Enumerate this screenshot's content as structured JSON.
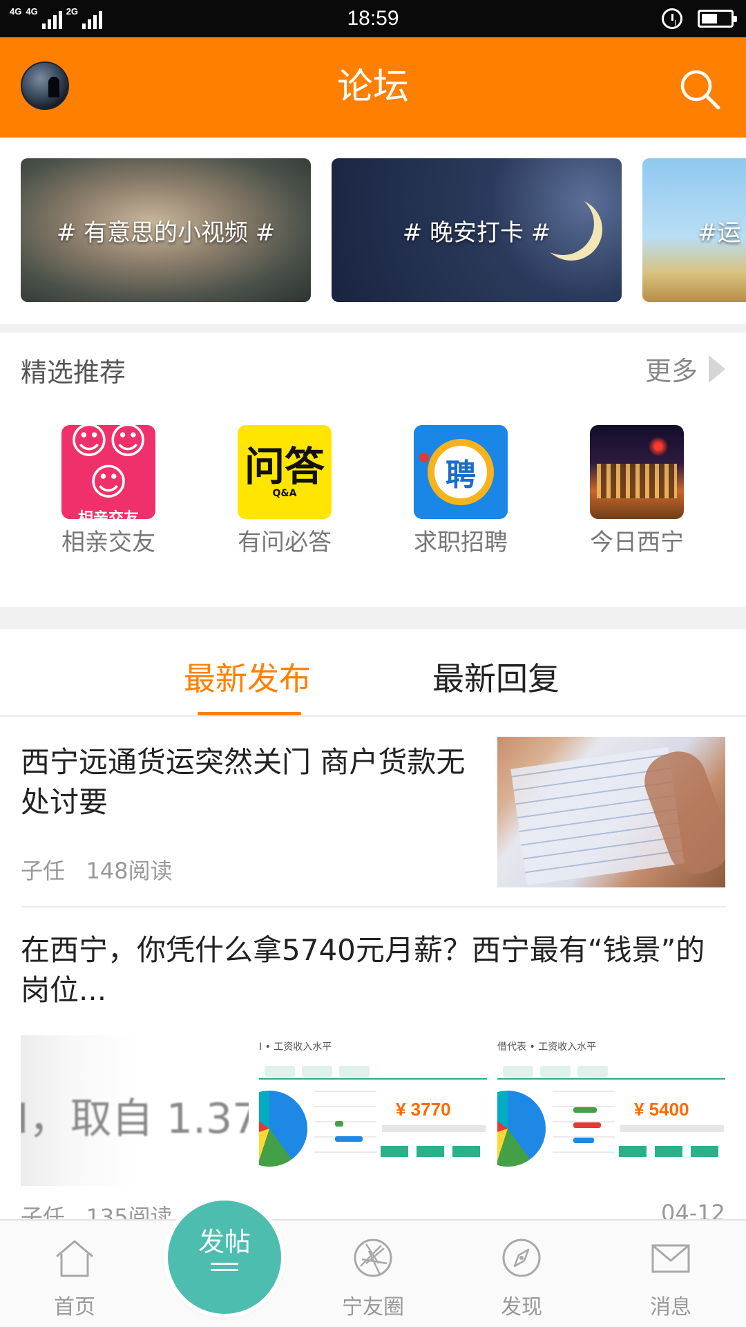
{
  "status_bar": {
    "network_1": "4G",
    "network_2": "4G",
    "network_3": "2G",
    "time": "18:59",
    "battery_level": 0.55
  },
  "header": {
    "title": "论坛",
    "search_icon": "search-icon",
    "avatar_icon": "avatar"
  },
  "banners": [
    {
      "label": "# 有意思的小视频 #"
    },
    {
      "label": "# 晚安打卡 #"
    },
    {
      "label": "#运"
    }
  ],
  "featured": {
    "title": "精选推荐",
    "more_label": "更多",
    "items": [
      {
        "label": "相亲交友",
        "icon_caption": "相亲交友",
        "icon": "dating-icon"
      },
      {
        "label": "有问必答",
        "icon_big": "问答",
        "icon_small": "Q&A",
        "icon": "qa-icon"
      },
      {
        "label": "求职招聘",
        "icon_char": "聘",
        "icon": "job-icon"
      },
      {
        "label": "今日西宁",
        "icon": "city-icon"
      }
    ]
  },
  "tabs": {
    "latest": "最新发布",
    "reply": "最新回复",
    "active": "latest"
  },
  "posts": [
    {
      "title": "西宁远通货运突然关门 商户货款无处讨要",
      "author": "子任",
      "reads": "148阅读"
    },
    {
      "title": "在西宁，你凭什么拿5740元月薪？西宁最有“钱景”的岗位...",
      "author": "子任",
      "reads": "135阅读",
      "date": "04-12",
      "image_1_text": "I，取自 1.37",
      "image_2_heading": "I • 工资收入水平",
      "image_2_price": "¥ 3770",
      "image_3_heading": "借代表 • 工资收入水平",
      "image_3_price": "¥ 5400"
    }
  ],
  "bottom_nav": {
    "home": "首页",
    "post_button": "发帖",
    "friends": "宁友圈",
    "discover": "发现",
    "messages": "消息"
  },
  "colors": {
    "accent": "#ff8000",
    "fab": "#4dbdaf",
    "text_muted": "#999999"
  }
}
